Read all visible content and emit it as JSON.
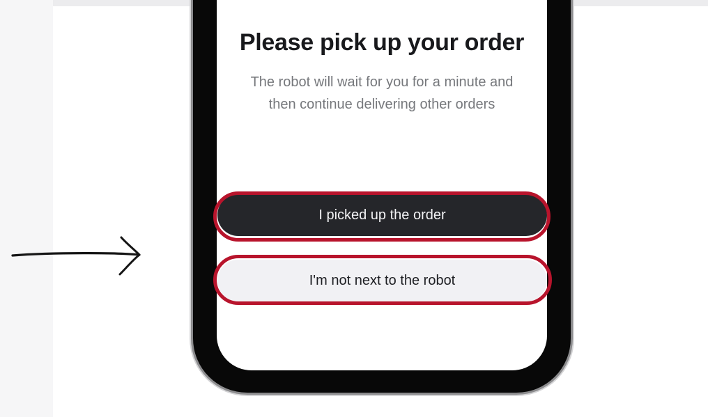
{
  "screen": {
    "title": "Please pick up your order",
    "subtitle_line1": "The robot will wait for you for a minute and",
    "subtitle_line2": "then continue delivering other orders"
  },
  "actions": {
    "picked_up_label": "I picked up the order",
    "not_next_label": "I'm not next to the robot"
  },
  "annotations": {
    "pointer_icon": "hand-drawn-arrow-icon",
    "highlight_color": "#b8142c"
  },
  "colors": {
    "primary_button": "#25262a",
    "secondary_button": "#f1f1f4",
    "title_text": "#18191c",
    "subtitle_text": "#76787c",
    "phone_frame": "#080808"
  }
}
